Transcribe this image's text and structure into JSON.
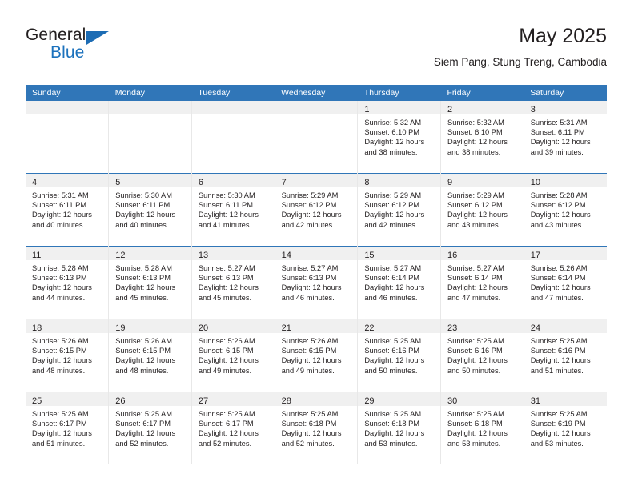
{
  "brand": {
    "name_top": "General",
    "name_bottom": "Blue",
    "accent_color": "#1c72bd",
    "triangle_color": "#1c6cb4"
  },
  "header": {
    "title": "May 2025",
    "subtitle": "Siem Pang, Stung Treng, Cambodia"
  },
  "calendar": {
    "header_bg": "#3076b8",
    "header_text_color": "#ffffff",
    "daynum_band_bg": "#f0f0f0",
    "weekdays": [
      "Sunday",
      "Monday",
      "Tuesday",
      "Wednesday",
      "Thursday",
      "Friday",
      "Saturday"
    ],
    "weeks": [
      [
        {
          "day": "",
          "sunrise": "",
          "sunset": "",
          "daylight_line1": "",
          "daylight_line2": ""
        },
        {
          "day": "",
          "sunrise": "",
          "sunset": "",
          "daylight_line1": "",
          "daylight_line2": ""
        },
        {
          "day": "",
          "sunrise": "",
          "sunset": "",
          "daylight_line1": "",
          "daylight_line2": ""
        },
        {
          "day": "",
          "sunrise": "",
          "sunset": "",
          "daylight_line1": "",
          "daylight_line2": ""
        },
        {
          "day": "1",
          "sunrise": "Sunrise: 5:32 AM",
          "sunset": "Sunset: 6:10 PM",
          "daylight_line1": "Daylight: 12 hours",
          "daylight_line2": "and 38 minutes."
        },
        {
          "day": "2",
          "sunrise": "Sunrise: 5:32 AM",
          "sunset": "Sunset: 6:10 PM",
          "daylight_line1": "Daylight: 12 hours",
          "daylight_line2": "and 38 minutes."
        },
        {
          "day": "3",
          "sunrise": "Sunrise: 5:31 AM",
          "sunset": "Sunset: 6:11 PM",
          "daylight_line1": "Daylight: 12 hours",
          "daylight_line2": "and 39 minutes."
        }
      ],
      [
        {
          "day": "4",
          "sunrise": "Sunrise: 5:31 AM",
          "sunset": "Sunset: 6:11 PM",
          "daylight_line1": "Daylight: 12 hours",
          "daylight_line2": "and 40 minutes."
        },
        {
          "day": "5",
          "sunrise": "Sunrise: 5:30 AM",
          "sunset": "Sunset: 6:11 PM",
          "daylight_line1": "Daylight: 12 hours",
          "daylight_line2": "and 40 minutes."
        },
        {
          "day": "6",
          "sunrise": "Sunrise: 5:30 AM",
          "sunset": "Sunset: 6:11 PM",
          "daylight_line1": "Daylight: 12 hours",
          "daylight_line2": "and 41 minutes."
        },
        {
          "day": "7",
          "sunrise": "Sunrise: 5:29 AM",
          "sunset": "Sunset: 6:12 PM",
          "daylight_line1": "Daylight: 12 hours",
          "daylight_line2": "and 42 minutes."
        },
        {
          "day": "8",
          "sunrise": "Sunrise: 5:29 AM",
          "sunset": "Sunset: 6:12 PM",
          "daylight_line1": "Daylight: 12 hours",
          "daylight_line2": "and 42 minutes."
        },
        {
          "day": "9",
          "sunrise": "Sunrise: 5:29 AM",
          "sunset": "Sunset: 6:12 PM",
          "daylight_line1": "Daylight: 12 hours",
          "daylight_line2": "and 43 minutes."
        },
        {
          "day": "10",
          "sunrise": "Sunrise: 5:28 AM",
          "sunset": "Sunset: 6:12 PM",
          "daylight_line1": "Daylight: 12 hours",
          "daylight_line2": "and 43 minutes."
        }
      ],
      [
        {
          "day": "11",
          "sunrise": "Sunrise: 5:28 AM",
          "sunset": "Sunset: 6:13 PM",
          "daylight_line1": "Daylight: 12 hours",
          "daylight_line2": "and 44 minutes."
        },
        {
          "day": "12",
          "sunrise": "Sunrise: 5:28 AM",
          "sunset": "Sunset: 6:13 PM",
          "daylight_line1": "Daylight: 12 hours",
          "daylight_line2": "and 45 minutes."
        },
        {
          "day": "13",
          "sunrise": "Sunrise: 5:27 AM",
          "sunset": "Sunset: 6:13 PM",
          "daylight_line1": "Daylight: 12 hours",
          "daylight_line2": "and 45 minutes."
        },
        {
          "day": "14",
          "sunrise": "Sunrise: 5:27 AM",
          "sunset": "Sunset: 6:13 PM",
          "daylight_line1": "Daylight: 12 hours",
          "daylight_line2": "and 46 minutes."
        },
        {
          "day": "15",
          "sunrise": "Sunrise: 5:27 AM",
          "sunset": "Sunset: 6:14 PM",
          "daylight_line1": "Daylight: 12 hours",
          "daylight_line2": "and 46 minutes."
        },
        {
          "day": "16",
          "sunrise": "Sunrise: 5:27 AM",
          "sunset": "Sunset: 6:14 PM",
          "daylight_line1": "Daylight: 12 hours",
          "daylight_line2": "and 47 minutes."
        },
        {
          "day": "17",
          "sunrise": "Sunrise: 5:26 AM",
          "sunset": "Sunset: 6:14 PM",
          "daylight_line1": "Daylight: 12 hours",
          "daylight_line2": "and 47 minutes."
        }
      ],
      [
        {
          "day": "18",
          "sunrise": "Sunrise: 5:26 AM",
          "sunset": "Sunset: 6:15 PM",
          "daylight_line1": "Daylight: 12 hours",
          "daylight_line2": "and 48 minutes."
        },
        {
          "day": "19",
          "sunrise": "Sunrise: 5:26 AM",
          "sunset": "Sunset: 6:15 PM",
          "daylight_line1": "Daylight: 12 hours",
          "daylight_line2": "and 48 minutes."
        },
        {
          "day": "20",
          "sunrise": "Sunrise: 5:26 AM",
          "sunset": "Sunset: 6:15 PM",
          "daylight_line1": "Daylight: 12 hours",
          "daylight_line2": "and 49 minutes."
        },
        {
          "day": "21",
          "sunrise": "Sunrise: 5:26 AM",
          "sunset": "Sunset: 6:15 PM",
          "daylight_line1": "Daylight: 12 hours",
          "daylight_line2": "and 49 minutes."
        },
        {
          "day": "22",
          "sunrise": "Sunrise: 5:25 AM",
          "sunset": "Sunset: 6:16 PM",
          "daylight_line1": "Daylight: 12 hours",
          "daylight_line2": "and 50 minutes."
        },
        {
          "day": "23",
          "sunrise": "Sunrise: 5:25 AM",
          "sunset": "Sunset: 6:16 PM",
          "daylight_line1": "Daylight: 12 hours",
          "daylight_line2": "and 50 minutes."
        },
        {
          "day": "24",
          "sunrise": "Sunrise: 5:25 AM",
          "sunset": "Sunset: 6:16 PM",
          "daylight_line1": "Daylight: 12 hours",
          "daylight_line2": "and 51 minutes."
        }
      ],
      [
        {
          "day": "25",
          "sunrise": "Sunrise: 5:25 AM",
          "sunset": "Sunset: 6:17 PM",
          "daylight_line1": "Daylight: 12 hours",
          "daylight_line2": "and 51 minutes."
        },
        {
          "day": "26",
          "sunrise": "Sunrise: 5:25 AM",
          "sunset": "Sunset: 6:17 PM",
          "daylight_line1": "Daylight: 12 hours",
          "daylight_line2": "and 52 minutes."
        },
        {
          "day": "27",
          "sunrise": "Sunrise: 5:25 AM",
          "sunset": "Sunset: 6:17 PM",
          "daylight_line1": "Daylight: 12 hours",
          "daylight_line2": "and 52 minutes."
        },
        {
          "day": "28",
          "sunrise": "Sunrise: 5:25 AM",
          "sunset": "Sunset: 6:18 PM",
          "daylight_line1": "Daylight: 12 hours",
          "daylight_line2": "and 52 minutes."
        },
        {
          "day": "29",
          "sunrise": "Sunrise: 5:25 AM",
          "sunset": "Sunset: 6:18 PM",
          "daylight_line1": "Daylight: 12 hours",
          "daylight_line2": "and 53 minutes."
        },
        {
          "day": "30",
          "sunrise": "Sunrise: 5:25 AM",
          "sunset": "Sunset: 6:18 PM",
          "daylight_line1": "Daylight: 12 hours",
          "daylight_line2": "and 53 minutes."
        },
        {
          "day": "31",
          "sunrise": "Sunrise: 5:25 AM",
          "sunset": "Sunset: 6:19 PM",
          "daylight_line1": "Daylight: 12 hours",
          "daylight_line2": "and 53 minutes."
        }
      ]
    ]
  }
}
